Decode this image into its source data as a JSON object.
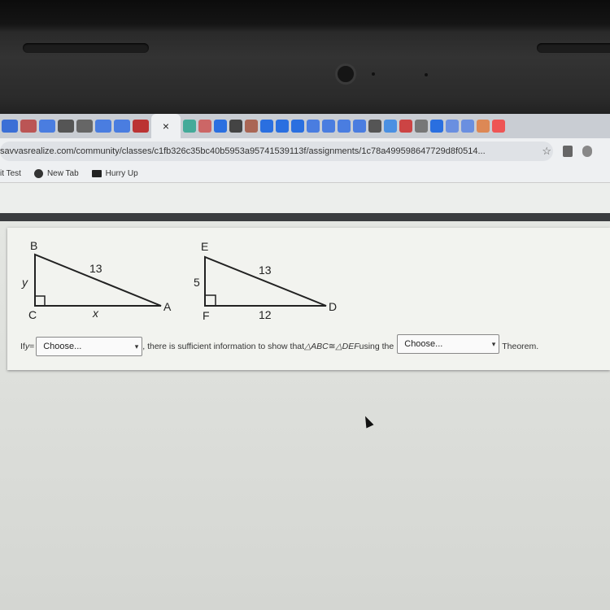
{
  "browser": {
    "active_tab_close": "×",
    "url": "savvasrealize.com/community/classes/c1fb326c35bc40b5953a95741539113f/assignments/1c78a499598647729d8f0514...",
    "bookmarks": [
      {
        "label": "it Test",
        "icon": "none"
      },
      {
        "label": "New Tab",
        "icon": "globe-icon"
      },
      {
        "label": "Hurry Up",
        "icon": "folder-icon"
      }
    ],
    "tab_colors": [
      "#3b6fd6",
      "#b55",
      "#4a7de0",
      "#555",
      "#666",
      "#4a7de0",
      "#4a7de0",
      "#b33"
    ],
    "tab_colors_right": [
      "#4a9",
      "#c66",
      "#2a6fe0",
      "#444",
      "#a65",
      "#2a6fe0",
      "#2a6fe0",
      "#2a6fe0",
      "#4a7de0",
      "#4a7de0",
      "#4a7de0",
      "#4a7de0",
      "#555",
      "#4a90e2",
      "#c44",
      "#777",
      "#2a6fe0",
      "#6a8fe0",
      "#6a8fe0",
      "#d85",
      "#e55"
    ]
  },
  "figure": {
    "triangle_abc": {
      "vertices": {
        "B": "B",
        "C": "C",
        "A": "A"
      },
      "sides": {
        "BC": "y",
        "CA": "x",
        "AB": "13"
      }
    },
    "triangle_def": {
      "vertices": {
        "E": "E",
        "F": "F",
        "D": "D"
      },
      "sides": {
        "EF": "5",
        "FD": "12",
        "DE": "13"
      }
    }
  },
  "question": {
    "prefix": "If ",
    "var": "y",
    "eq": " =",
    "select1": {
      "value": "Choose..."
    },
    "middle": ", there is sufficient information to show that ",
    "tri1": "△ABC",
    "congruent": " ≅ ",
    "tri2": "△DEF",
    "using": " using the",
    "select2": {
      "value": "Choose..."
    },
    "suffix": "Theorem."
  }
}
